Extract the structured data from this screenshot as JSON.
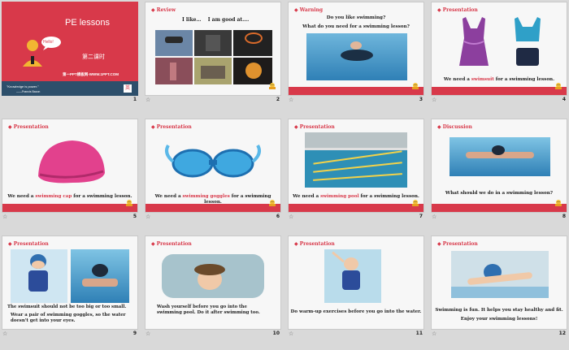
{
  "slides": [
    {
      "num": "1",
      "title": "PE lessons",
      "subtitle": "第二课时",
      "hello": "Hello!",
      "site": "第一PPT模板网-WWW.1PPT.COM",
      "quote": "\"Knowledge is power.\"",
      "author": "——Francis Bacon",
      "badge": "英"
    },
    {
      "num": "2",
      "header": "Review",
      "top_text": "I like…    I am good at…."
    },
    {
      "num": "3",
      "header": "Warning",
      "line1": "Do you like swimming?",
      "line2": "What do you need for a swimming lesson?"
    },
    {
      "num": "4",
      "header": "Presentation",
      "cap_pre": "We need a ",
      "cap_hl": "swimsuit",
      "cap_post": " for a swimming lesson."
    },
    {
      "num": "5",
      "header": "Presentation",
      "cap_pre": "We need a ",
      "cap_hl": "swimming cap",
      "cap_post": " for a swimming lesson."
    },
    {
      "num": "6",
      "header": "Presentation",
      "cap_pre": "We need a ",
      "cap_hl": "swimming goggles",
      "cap_post": " for a swimming lesson."
    },
    {
      "num": "7",
      "header": "Presentation",
      "cap_pre": "We need a ",
      "cap_hl": "swimming pool",
      "cap_post": " for a swimming lesson."
    },
    {
      "num": "8",
      "header": "Discussion",
      "question": "What should we do in a swimming lesson?"
    },
    {
      "num": "9",
      "header": "Presentation",
      "text1": "The swimsuit should not be too big or too small.",
      "text2": "Wear a pair of swimming goggles, so the water doesn't get into your eyes."
    },
    {
      "num": "10",
      "header": "Presentation",
      "text": "Wash yourself before you go into the swimming pool. Do it after swimming too."
    },
    {
      "num": "11",
      "header": "Presentation",
      "text": "Do warm-up exercises before you go into the water."
    },
    {
      "num": "12",
      "header": "Presentation",
      "text1": "Swimming is fun. It helps you stay healthy and fit.",
      "text2": "Enjoy your swimming lessons!"
    }
  ],
  "colors": {
    "accent": "#d8394a",
    "water": "#3d8cc0"
  }
}
